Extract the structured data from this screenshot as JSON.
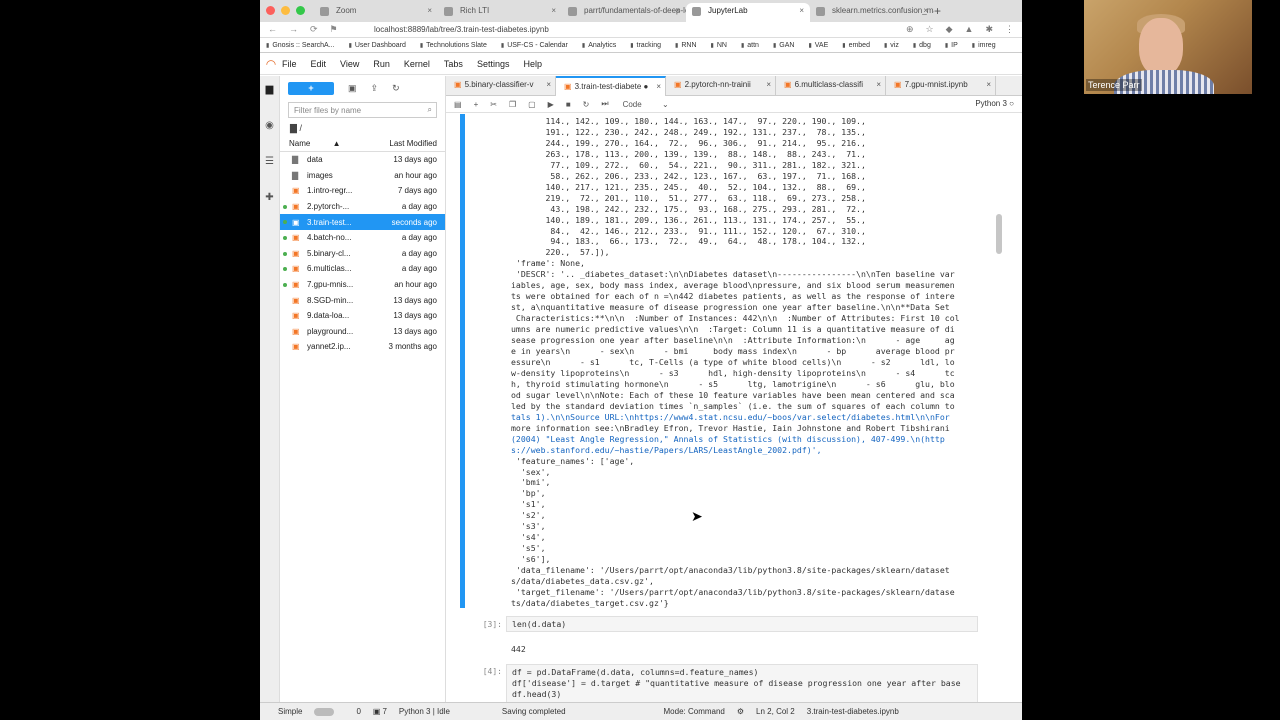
{
  "speaker": {
    "name": "Terence Parr"
  },
  "browser": {
    "tabs": [
      {
        "label": "Zoom"
      },
      {
        "label": "Rich LTI"
      },
      {
        "label": "parrt/fundamentals-of-deep-learn"
      },
      {
        "label": "JupyterLab",
        "active": true
      },
      {
        "label": "sklearn.metrics.confusion_matrix"
      }
    ],
    "new_tab": "+",
    "url": "localhost:8889/lab/tree/3.train-test-diabetes.ipynb",
    "bookmarks": [
      "Gnosis :: SearchA...",
      "User Dashboard",
      "Technolutions Slate",
      "USF-CS - Calendar",
      "Analytics",
      "tracking",
      "RNN",
      "NN",
      "attn",
      "GAN",
      "VAE",
      "embed",
      "viz",
      "dbg",
      "IP",
      "imreg"
    ]
  },
  "jupyter": {
    "menu": [
      "File",
      "Edit",
      "View",
      "Run",
      "Kernel",
      "Tabs",
      "Settings",
      "Help"
    ],
    "filebrowser": {
      "new_label": "+",
      "filter_placeholder": "Filter files by name",
      "breadcrumb": "/",
      "col_name": "Name",
      "col_modified": "Last Modified",
      "items": [
        {
          "name": "data",
          "modified": "13 days ago",
          "type": "folder",
          "running": false
        },
        {
          "name": "images",
          "modified": "an hour ago",
          "type": "folder",
          "running": false
        },
        {
          "name": "1.intro-regr...",
          "modified": "7 days ago",
          "type": "notebook",
          "running": false
        },
        {
          "name": "2.pytorch-...",
          "modified": "a day ago",
          "type": "notebook",
          "running": true
        },
        {
          "name": "3.train-test...",
          "modified": "seconds ago",
          "type": "notebook",
          "running": true,
          "selected": true
        },
        {
          "name": "4.batch-no...",
          "modified": "a day ago",
          "type": "notebook",
          "running": true
        },
        {
          "name": "5.binary-cl...",
          "modified": "a day ago",
          "type": "notebook",
          "running": true
        },
        {
          "name": "6.multiclas...",
          "modified": "a day ago",
          "type": "notebook",
          "running": true
        },
        {
          "name": "7.gpu-mnis...",
          "modified": "an hour ago",
          "type": "notebook",
          "running": true
        },
        {
          "name": "8.SGD-min...",
          "modified": "13 days ago",
          "type": "notebook",
          "running": false
        },
        {
          "name": "9.data-loa...",
          "modified": "13 days ago",
          "type": "notebook",
          "running": false
        },
        {
          "name": "playground...",
          "modified": "13 days ago",
          "type": "notebook",
          "running": false
        },
        {
          "name": "yannet2.ip...",
          "modified": "3 months ago",
          "type": "notebook",
          "running": false
        }
      ]
    },
    "notebook_tabs": [
      {
        "label": "5.binary-classifier-v"
      },
      {
        "label": "3.train-test-diabete ●",
        "active": true
      },
      {
        "label": "2.pytorch-nn-trainii"
      },
      {
        "label": "6.multiclass-classifi"
      },
      {
        "label": "7.gpu-mnist.ipynb"
      }
    ],
    "toolbar": {
      "cell_type": "Code",
      "kernel": "Python 3"
    },
    "output_lines": [
      "       114., 142., 109., 180., 144., 163., 147.,  97., 220., 190., 109.,",
      "       191., 122., 230., 242., 248., 249., 192., 131., 237.,  78., 135.,",
      "       244., 199., 270., 164.,  72.,  96., 306.,  91., 214.,  95., 216.,",
      "       263., 178., 113., 200., 139., 139.,  88., 148.,  88., 243.,  71.,",
      "        77., 109., 272.,  60.,  54., 221.,  90., 311., 281., 182., 321.,",
      "        58., 262., 206., 233., 242., 123., 167.,  63., 197.,  71., 168.,",
      "       140., 217., 121., 235., 245.,  40.,  52., 104., 132.,  88.,  69.,",
      "       219.,  72., 201., 110.,  51., 277.,  63., 118.,  69., 273., 258.,",
      "        43., 198., 242., 232., 175.,  93., 168., 275., 293., 281.,  72.,",
      "       140., 189., 181., 209., 136., 261., 113., 131., 174., 257.,  55.,",
      "        84.,  42., 146., 212., 233.,  91., 111., 152., 120.,  67., 310.,",
      "        94., 183.,  66., 173.,  72.,  49.,  64.,  48., 178., 104., 132.,",
      "       220.,  57.]),",
      " 'frame': None,",
      " 'DESCR': '.. _diabetes_dataset:\\n\\nDiabetes dataset\\n----------------\\n\\nTen baseline var",
      "iables, age, sex, body mass index, average blood\\npressure, and six blood serum measuremen",
      "ts were obtained for each of n =\\n442 diabetes patients, as well as the response of intere",
      "st, a\\nquantitative measure of disease progression one year after baseline.\\n\\n**Data Set",
      " Characteristics:**\\n\\n  :Number of Instances: 442\\n\\n  :Number of Attributes: First 10 col",
      "umns are numeric predictive values\\n\\n  :Target: Column 11 is a quantitative measure of di",
      "sease progression one year after baseline\\n\\n  :Attribute Information:\\n      - age     ag",
      "e in years\\n      - sex\\n      - bmi     body mass index\\n      - bp      average blood pr",
      "essure\\n      - s1      tc, T-Cells (a type of white blood cells)\\n      - s2      ldl, lo",
      "w-density lipoproteins\\n      - s3      hdl, high-density lipoproteins\\n      - s4      tc",
      "h, thyroid stimulating hormone\\n      - s5      ltg, lamotrigine\\n      - s6      glu, blo",
      "od sugar level\\n\\nNote: Each of these 10 feature variables have been mean centered and sca",
      "led by the standard deviation times `n_samples` (i.e. the sum of squares of each column to",
      "tals 1).\\n\\nSource URL:\\nhttps://www4.stat.ncsu.edu/~boos/var.select/diabetes.html\\n\\nFor",
      "more information see:\\nBradley Efron, Trevor Hastie, Iain Johnstone and Robert Tibshirani",
      "(2004) \"Least Angle Regression,\" Annals of Statistics (with discussion), 407-499.\\n(http",
      "s://web.stanford.edu/~hastie/Papers/LARS/LeastAngle_2002.pdf)',",
      " 'feature_names': ['age',",
      "  'sex',",
      "  'bmi',",
      "  'bp',",
      "  's1',",
      "  's2',",
      "  's3',",
      "  's4',",
      "  's5',",
      "  's6'],",
      " 'data_filename': '/Users/parrt/opt/anaconda3/lib/python3.8/site-packages/sklearn/dataset",
      "s/data/diabetes_data.csv.gz',",
      " 'target_filename': '/Users/parrt/opt/anaconda3/lib/python3.8/site-packages/sklearn/datase",
      "ts/data/diabetes_target.csv.gz'}"
    ],
    "cells": [
      {
        "prompt": "[3]:",
        "code": "len(d.data)",
        "output": "442"
      },
      {
        "prompt": "[4]:",
        "code": "df = pd.DataFrame(d.data, columns=d.feature_names)\ndf['disease'] = d.target # \"quantitative measure of disease progression one year after base\ndf.head(3)"
      }
    ],
    "status": {
      "mode_label": "Simple",
      "count_a": "0",
      "count_b": "7",
      "kernel": "Python 3 | Idle",
      "save_state": "Saving completed",
      "mode": "Mode: Command",
      "position": "Ln 2, Col 2",
      "file": "3.train-test-diabetes.ipynb"
    }
  },
  "colors": {
    "accent": "#2196f3",
    "notebook": "#f37626"
  }
}
